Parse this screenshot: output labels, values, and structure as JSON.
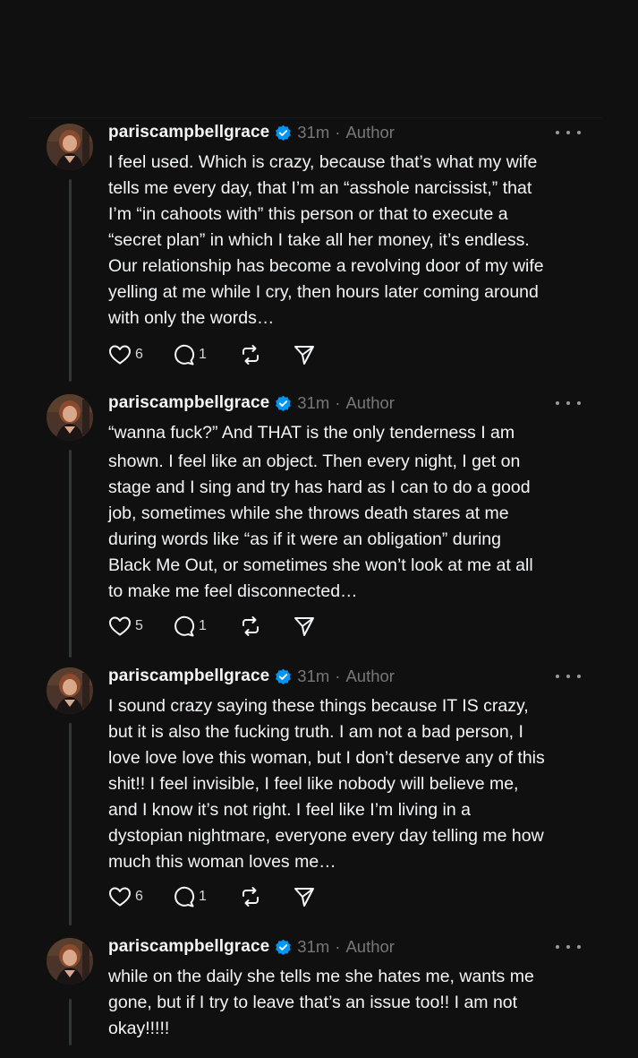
{
  "posts": [
    {
      "username": "pariscampbellgrace",
      "time": "31m",
      "separator": "·",
      "role": "Author",
      "lines": [
        "I feel used. Which is crazy, because that’s what my wife",
        "tells me every day, that I’m an “asshole narcissist,” that",
        "I’m “in cahoots with” this person or that to execute a",
        "“secret plan” in which I take all her money, it’s endless.",
        "Our relationship has become a revolving door of my wife",
        "yelling at me while I cry, then hours later coming around",
        "with only the words…"
      ],
      "likes": "6",
      "replies": "1"
    },
    {
      "username": "pariscampbellgrace",
      "time": "31m",
      "separator": "·",
      "role": "Author",
      "lines": [
        "“wanna fuck?” And THAT is the only tenderness I am",
        "shown. I feel like an object. Then every night, I get on",
        "stage and I sing and try has hard as I can to do a good",
        "job, sometimes while she throws death stares at me",
        "during words like “as if it were an obligation” during",
        "Black Me Out, or sometimes she won’t look at me at all",
        "to make me feel disconnected…"
      ],
      "likes": "5",
      "replies": "1"
    },
    {
      "username": "pariscampbellgrace",
      "time": "31m",
      "separator": "·",
      "role": "Author",
      "lines": [
        "I sound crazy saying these things because IT IS crazy,",
        "but it is also the fucking truth. I am not a bad person, I",
        "love love love this woman, but I don’t deserve any of this",
        "shit!! I feel invisible, I feel like nobody will believe me,",
        "and I know it’s not right. I feel like I’m living in a",
        "dystopian nightmare, everyone every day telling me how",
        "much this woman loves me…"
      ],
      "likes": "6",
      "replies": "1"
    },
    {
      "username": "pariscampbellgrace",
      "time": "31m",
      "separator": "·",
      "role": "Author",
      "lines": [
        "while on the daily she tells me she hates me, wants me",
        "gone, but if I try to leave that’s an issue too!! I am not",
        "okay!!!!!"
      ]
    }
  ],
  "icons": {
    "verified": "verified-badge-icon",
    "more": "more-options-icon",
    "like": "heart-icon",
    "reply": "comment-icon",
    "repost": "repost-icon",
    "share": "send-icon"
  },
  "colors": {
    "background": "#101010",
    "text": "#f3f5f7",
    "muted": "#777777",
    "verified": "#0095f6",
    "thread_line": "#333638"
  }
}
